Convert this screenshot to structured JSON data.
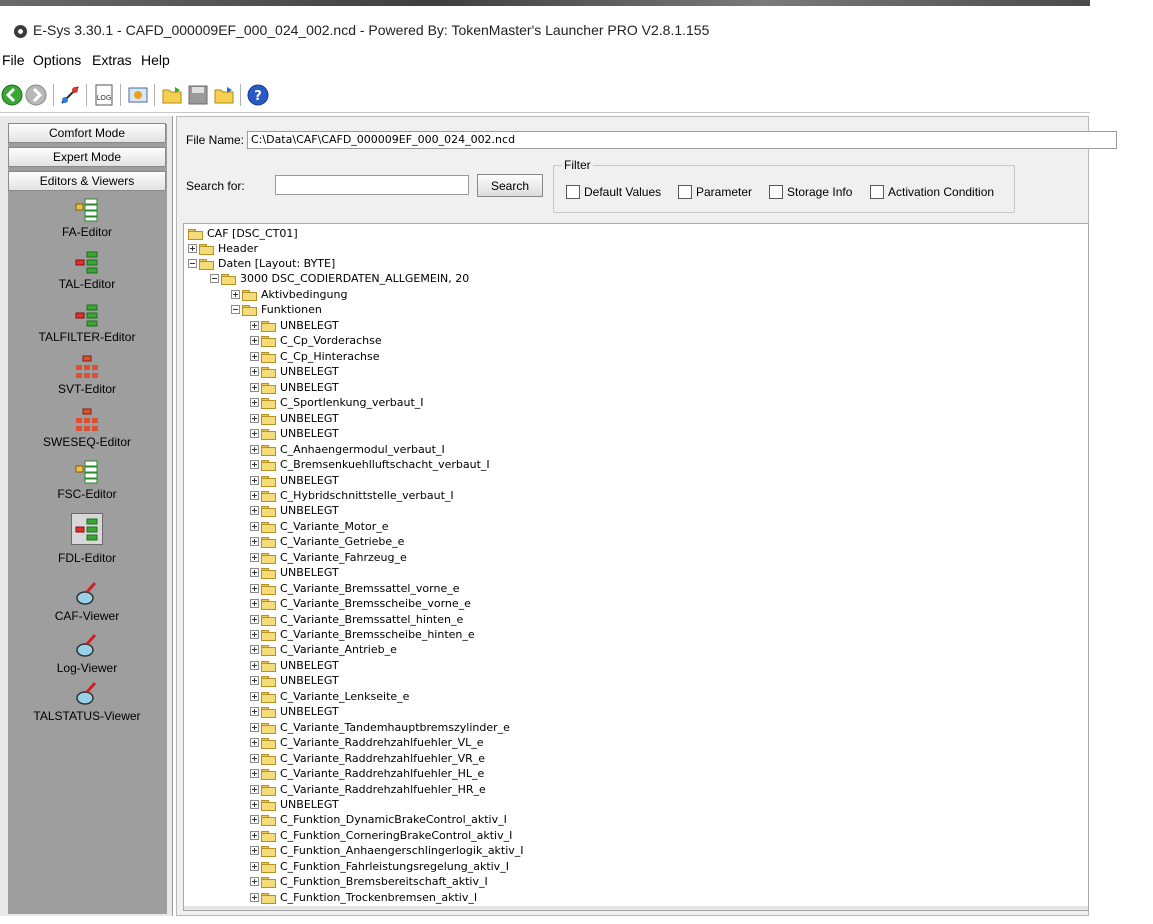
{
  "window": {
    "title": "E-Sys 3.30.1 - CAFD_000009EF_000_024_002.ncd   - Powered By: TokenMaster's Launcher PRO V2.8.1.155"
  },
  "menu": {
    "file": "File",
    "options": "Options",
    "extras": "Extras",
    "help": "Help"
  },
  "toolbar": {
    "buttons": [
      "back-icon",
      "forward-icon",
      "connect-icon",
      "log-icon",
      "import-icon",
      "open-icon",
      "save-icon",
      "open-folder-icon",
      "help-icon"
    ]
  },
  "sidebar": {
    "modes": [
      "Comfort Mode",
      "Expert Mode",
      "Editors & Viewers"
    ],
    "tools": [
      "FA-Editor",
      "TAL-Editor",
      "TALFILTER-Editor",
      "SVT-Editor",
      "SWESEQ-Editor",
      "FSC-Editor",
      "FDL-Editor",
      "CAF-Viewer",
      "Log-Viewer",
      "TALSTATUS-Viewer"
    ],
    "selected_tool": "FDL-Editor"
  },
  "main": {
    "file_name_label": "File Name:",
    "file_name_value": "C:\\Data\\CAF\\CAFD_000009EF_000_024_002.ncd",
    "search_label": "Search for:",
    "search_value": "",
    "search_button": "Search",
    "filter": {
      "legend": "Filter",
      "options": [
        "Default Values",
        "Parameter",
        "Storage Info",
        "Activation Condition"
      ]
    }
  },
  "tree": {
    "root": "CAF [DSC_CT01]",
    "header": "Header",
    "daten": "Daten [Layout: BYTE]",
    "block": "3000 DSC_CODIERDATEN_ALLGEMEIN, 20",
    "aktiv": "Aktivbedingung",
    "funktionen": "Funktionen",
    "items": [
      "UNBELEGT",
      "C_Cp_Vorderachse",
      "C_Cp_Hinterachse",
      "UNBELEGT",
      "UNBELEGT",
      "C_Sportlenkung_verbaut_I",
      "UNBELEGT",
      "UNBELEGT",
      "C_Anhaengermodul_verbaut_I",
      "C_Bremsenkuehlluftschacht_verbaut_I",
      "UNBELEGT",
      "C_Hybridschnittstelle_verbaut_I",
      "UNBELEGT",
      "C_Variante_Motor_e",
      "C_Variante_Getriebe_e",
      "C_Variante_Fahrzeug_e",
      "UNBELEGT",
      "C_Variante_Bremssattel_vorne_e",
      "C_Variante_Bremsscheibe_vorne_e",
      "C_Variante_Bremssattel_hinten_e",
      "C_Variante_Bremsscheibe_hinten_e",
      "C_Variante_Antrieb_e",
      "UNBELEGT",
      "UNBELEGT",
      "C_Variante_Lenkseite_e",
      "UNBELEGT",
      "C_Variante_Tandemhauptbremszylinder_e",
      "C_Variante_Raddrehzahlfuehler_VL_e",
      "C_Variante_Raddrehzahlfuehler_VR_e",
      "C_Variante_Raddrehzahlfuehler_HL_e",
      "C_Variante_Raddrehzahlfuehler_HR_e",
      "UNBELEGT",
      "C_Funktion_DynamicBrakeControl_aktiv_I",
      "C_Funktion_CorneringBrakeControl_aktiv_I",
      "C_Funktion_Anhaengerschlingerlogik_aktiv_I",
      "C_Funktion_Fahrleistungsregelung_aktiv_I",
      "C_Funktion_Bremsbereitschaft_aktiv_I",
      "C_Funktion_Trockenbremsen_aktiv_I"
    ]
  }
}
